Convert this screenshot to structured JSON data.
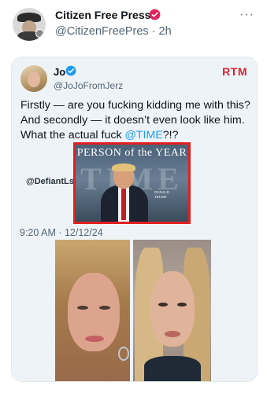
{
  "post": {
    "author_name": "Citizen Free Press",
    "handle_time": "@CitizenFreePres · 2h",
    "more_label": "···",
    "verified_color": "#e0245e"
  },
  "quote": {
    "name": "Jo",
    "handle": "@JoJoFromJerz",
    "brand": "RTM",
    "text_part1": "Firstly — are you fucking kidding me with this? And secondly — it doesn’t even look like him. What the actual fuck ",
    "mention": "@TIME",
    "text_part2": "?!?",
    "watermark": "@DefiantLs",
    "timestamp": "9:20 AM · 12/12/24",
    "verified_color": "#1d9bf0"
  },
  "time_cover": {
    "headline": "PERSON of the YEAR",
    "wordmark": "TIME",
    "caption_line1": "DONALD",
    "caption_line2": "TRUMP"
  }
}
